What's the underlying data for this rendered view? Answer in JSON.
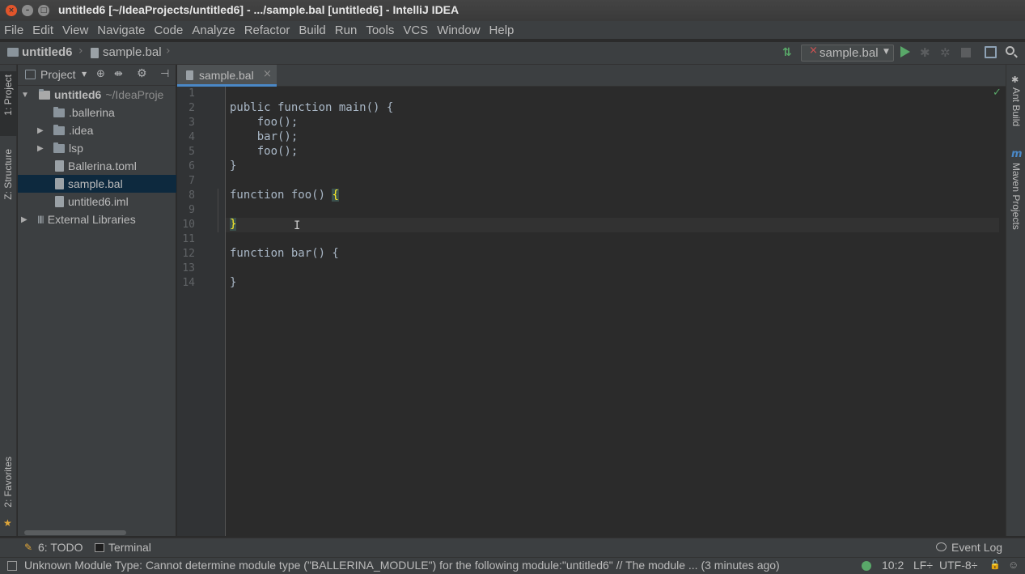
{
  "window": {
    "title": "untitled6 [~/IdeaProjects/untitled6] - .../sample.bal [untitled6] - IntelliJ IDEA"
  },
  "menu": [
    "File",
    "Edit",
    "View",
    "Navigate",
    "Code",
    "Analyze",
    "Refactor",
    "Build",
    "Run",
    "Tools",
    "VCS",
    "Window",
    "Help"
  ],
  "breadcrumb": {
    "project": "untitled6",
    "file": "sample.bal"
  },
  "run_config": {
    "label": "sample.bal"
  },
  "left_tools": {
    "project": "1: Project",
    "structure": "Z: Structure",
    "favorites": "2: Favorites"
  },
  "right_tools": {
    "ant": "Ant Build",
    "maven": "Maven Projects"
  },
  "project_panel": {
    "view_label": "Project",
    "tree": [
      {
        "label": "untitled6",
        "suffix": "~/IdeaProje"
      },
      {
        "label": ".ballerina"
      },
      {
        "label": ".idea"
      },
      {
        "label": "lsp"
      },
      {
        "label": "Ballerina.toml"
      },
      {
        "label": "sample.bal"
      },
      {
        "label": "untitled6.iml"
      },
      {
        "label": "External Libraries"
      }
    ]
  },
  "editor": {
    "tab_label": "sample.bal",
    "line_numbers": [
      "1",
      "2",
      "3",
      "4",
      "5",
      "6",
      "7",
      "8",
      "9",
      "10",
      "11",
      "12",
      "13",
      "14"
    ],
    "lines": [
      "",
      "public function main() {",
      "    foo();",
      "    bar();",
      "    foo();",
      "}",
      "",
      "function foo() {",
      "",
      "}",
      "",
      "function bar() {",
      "",
      "}"
    ]
  },
  "bottom_tools": {
    "todo": "6: TODO",
    "terminal": "Terminal",
    "event_log": "Event Log"
  },
  "status": {
    "message": "Unknown Module Type: Cannot determine module type (\"BALLERINA_MODULE\") for the following module:\"untitled6\" // The module ... (3 minutes ago)",
    "position": "10:2",
    "line_sep": "LF÷",
    "encoding": "UTF-8÷"
  },
  "colors": {
    "accent": "#4a88c7",
    "selection": "#0d293e",
    "brace_match": "#3b514d",
    "run": "#59a869"
  }
}
